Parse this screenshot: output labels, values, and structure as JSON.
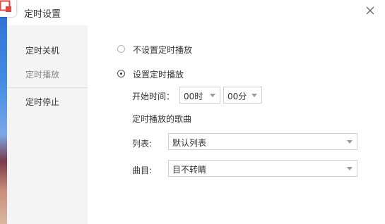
{
  "dialog": {
    "title": "定时设置"
  },
  "sidebar": {
    "items": [
      {
        "label": "定时关机"
      },
      {
        "label": "定时播放"
      },
      {
        "label": "定时停止"
      }
    ]
  },
  "options": {
    "no_schedule": {
      "label": "不设置定时播放",
      "selected": false
    },
    "set_schedule": {
      "label": "设置定时播放",
      "selected": true
    }
  },
  "start_time": {
    "label": "开始时间：",
    "hour": "00时",
    "minute": "00分"
  },
  "songs_section": {
    "heading": "定时播放的歌曲",
    "list_label": "列表:",
    "list_value": "默认列表",
    "track_label": "曲目:",
    "track_value": "目不转睛"
  },
  "colors": {
    "sidebar_bg": "#f4f4f4",
    "border": "#cfcfcf",
    "text": "#333333",
    "muted_text": "#888888"
  }
}
